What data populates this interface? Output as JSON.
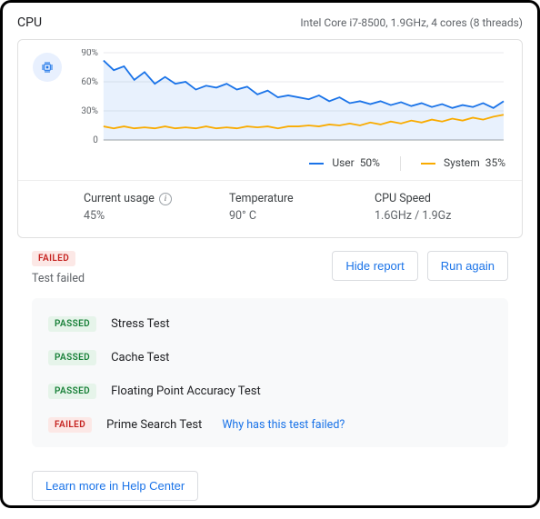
{
  "header": {
    "title": "CPU",
    "subtitle": "Intel Core i7-8500, 1.9GHz, 4 cores (8 threads)"
  },
  "chart_data": {
    "type": "line",
    "ylim": [
      0,
      90
    ],
    "y_ticks": [
      "90%",
      "60%",
      "30%",
      "0"
    ],
    "x": [
      0,
      1,
      2,
      3,
      4,
      5,
      6,
      7,
      8,
      9,
      10,
      11,
      12,
      13,
      14,
      15,
      16,
      17,
      18,
      19,
      20,
      21,
      22,
      23,
      24,
      25,
      26,
      27,
      28,
      29,
      30,
      31,
      32,
      33,
      34,
      35,
      36,
      37,
      38,
      39
    ],
    "series": [
      {
        "name": "User",
        "color": "#1a73e8",
        "values": [
          82,
          72,
          76,
          62,
          70,
          58,
          65,
          58,
          60,
          52,
          56,
          54,
          58,
          52,
          55,
          47,
          51,
          44,
          46,
          44,
          42,
          46,
          40,
          44,
          38,
          40,
          37,
          40,
          36,
          39,
          35,
          38,
          34,
          37,
          33,
          36,
          34,
          38,
          33,
          40
        ]
      },
      {
        "name": "System",
        "color": "#f9ab00",
        "values": [
          14,
          12,
          14,
          12,
          13,
          12,
          14,
          12,
          13,
          12,
          14,
          12,
          13,
          12,
          14,
          13,
          14,
          12,
          14,
          14,
          15,
          14,
          16,
          15,
          17,
          15,
          18,
          16,
          19,
          17,
          20,
          18,
          21,
          19,
          22,
          20,
          23,
          21,
          24,
          26
        ]
      }
    ],
    "legend": [
      {
        "name": "User",
        "value": "50%",
        "color": "#1a73e8"
      },
      {
        "name": "System",
        "value": "35%",
        "color": "#f9ab00"
      }
    ]
  },
  "metrics": {
    "usage": {
      "label": "Current usage",
      "value": "45%"
    },
    "temp": {
      "label": "Temperature",
      "value": "90° C"
    },
    "speed": {
      "label": "CPU Speed",
      "value": "1.6GHz / 1.9Gz"
    }
  },
  "tests": {
    "overall_badge": "FAILED",
    "overall_text": "Test failed",
    "hide_label": "Hide report",
    "run_label": "Run again",
    "why_label": "Why has this test failed?",
    "items": [
      {
        "status": "PASSED",
        "name": "Stress Test"
      },
      {
        "status": "PASSED",
        "name": "Cache Test"
      },
      {
        "status": "PASSED",
        "name": "Floating Point Accuracy Test"
      },
      {
        "status": "FAILED",
        "name": "Prime Search Test"
      }
    ]
  },
  "footer": {
    "learn_more": "Learn more in Help Center"
  }
}
